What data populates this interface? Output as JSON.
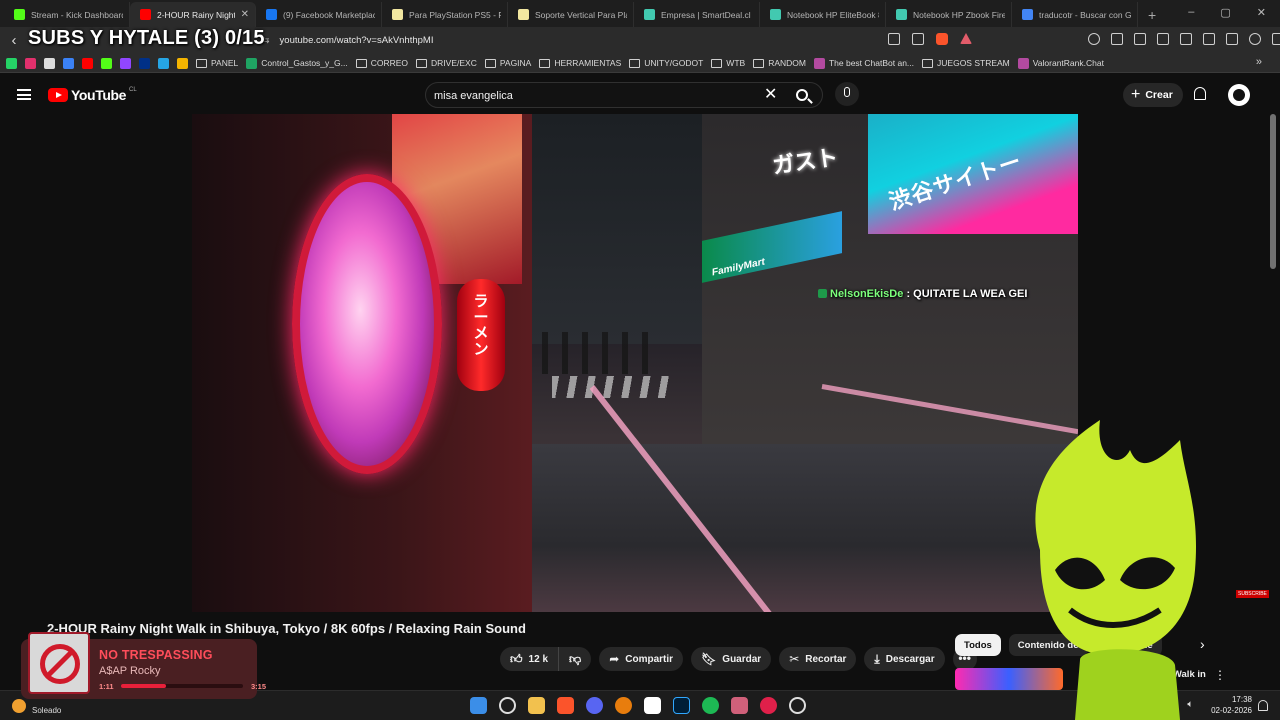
{
  "browser": {
    "tabs": [
      {
        "title": "Stream - Kick Dashboard",
        "color": "#53fc18"
      },
      {
        "title": "2-HOUR Rainy Night Walk",
        "color": "#ff0000",
        "active": true
      },
      {
        "title": "(9) Facebook Marketplace",
        "color": "#1877f2"
      },
      {
        "title": "Para PlayStation PS5 - Play",
        "color": "#f2e7a0"
      },
      {
        "title": "Soporte Vertical Para PlayS",
        "color": "#f2e7a0"
      },
      {
        "title": "Empresa | SmartDeal.cl",
        "color": "#42c9b0"
      },
      {
        "title": "Notebook HP EliteBook 8...",
        "color": "#42c9b0"
      },
      {
        "title": "Notebook HP Zbook Firefly",
        "color": "#42c9b0"
      },
      {
        "title": "traducotr - Buscar con Go",
        "color": "#4285f4"
      }
    ],
    "new_tab": "+",
    "url": "youtube.com/watch?v=sAkVnhthpMI",
    "window_controls": [
      "–",
      "▢",
      "✕"
    ]
  },
  "stream_overlay": {
    "title": "SUBS Y HYTALE (3) 0/15",
    "chat_user": "NelsonEkisDe",
    "chat_message": ": QUITATE LA WEA GEI",
    "subscribe_tag": "SUBSCRIBE"
  },
  "bookmarks": [
    {
      "label": "PANEL",
      "type": "folder"
    },
    {
      "label": "Control_Gastos_y_G...",
      "type": "sheet"
    },
    {
      "label": "CORREO",
      "type": "folder"
    },
    {
      "label": "DRIVE/EXC",
      "type": "folder"
    },
    {
      "label": "PAGINA",
      "type": "folder"
    },
    {
      "label": "HERRAMIENTAS",
      "type": "folder"
    },
    {
      "label": "UNITY/GODOT",
      "type": "folder"
    },
    {
      "label": "WTB",
      "type": "folder"
    },
    {
      "label": "RANDOM",
      "type": "folder"
    },
    {
      "label": "The best ChatBot an...",
      "type": "site"
    },
    {
      "label": "JUEGOS STREAM",
      "type": "folder"
    },
    {
      "label": "ValorantRank.Chat",
      "type": "site"
    }
  ],
  "youtube": {
    "logo_word": "YouTube",
    "country": "CL",
    "search": {
      "value": "misa evangelica",
      "clear": "✕"
    },
    "create_label": "Crear",
    "video": {
      "title": "2-HOUR Rainy Night Walk in Shibuya, Tokyo / 8K 60fps / Relaxing Rain Sound",
      "likes": "12 k",
      "share_label": "Compartir",
      "save_label": "Guardar",
      "clip_label": "Recortar",
      "download_label": "Descargar",
      "more": "•••"
    },
    "scene_text": {
      "lantern": "ラーメン",
      "right_sign": "渋谷サイトー",
      "gusto": "ガスト",
      "familymart": "FamilyMart"
    },
    "chips": [
      "Todos",
      "Contenido de",
      "ado Ambie"
    ],
    "related": {
      "title": "Night Walk in",
      "more": "⋮"
    }
  },
  "music": {
    "title": "NO TRESPASSING",
    "artist": "A$AP Rocky",
    "current": "1:11",
    "duration": "3:15",
    "progress": 0.37
  },
  "taskbar": {
    "weather": "Soleado",
    "time": "17:38",
    "date": "02-02-2026"
  }
}
